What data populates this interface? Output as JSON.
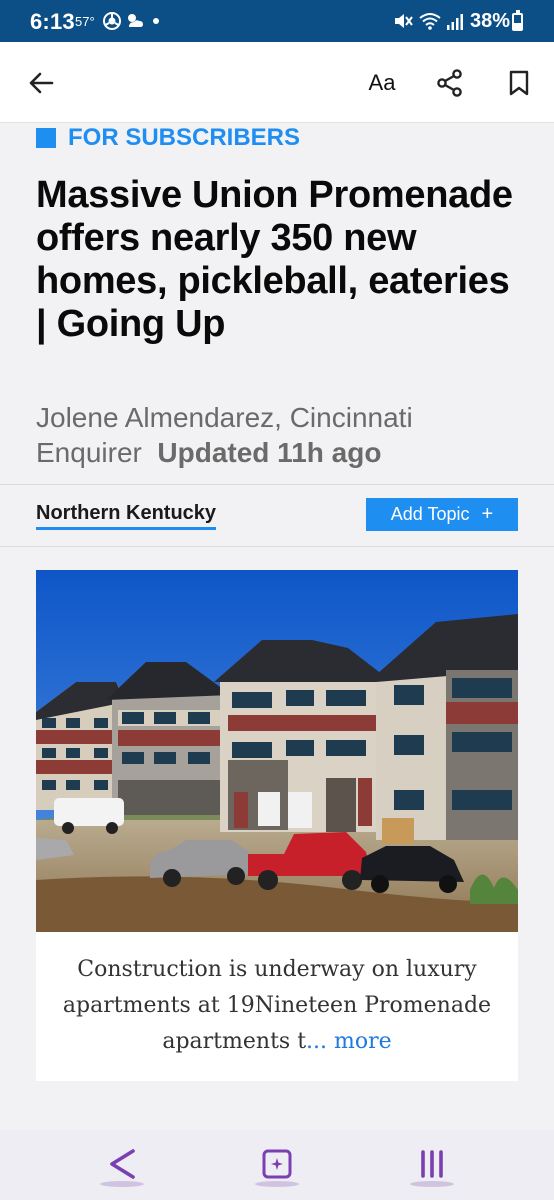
{
  "status_bar": {
    "time": "6:13",
    "temperature": "57°",
    "battery_percent": "38%",
    "icons": [
      "chrome-icon",
      "cloud-sun-icon",
      "mute-icon",
      "wifi-icon",
      "signal-icon",
      "battery-icon"
    ]
  },
  "app_bar": {
    "icons": [
      "back-arrow-icon",
      "text-size-icon",
      "share-icon",
      "bookmark-icon"
    ],
    "text_size_label": "Aa"
  },
  "article": {
    "badge_label": "FOR SUBSCRIBERS",
    "headline": "Massive Union Promenade offers nearly 350 new homes, pickleball, eateries | Going Up",
    "byline_author": "Jolene Almendarez, Cincinnati Enquirer",
    "byline_updated": "Updated 11h ago",
    "topic": "Northern Kentucky",
    "add_topic_label": "Add Topic",
    "add_topic_icon": "plus-icon",
    "caption_text": "Construction is underway on luxury apartments at 19Nineteen Promenade apartments t",
    "caption_more": "... more"
  },
  "nav_bar": {
    "icons": [
      "nav-back-icon",
      "nav-home-icon",
      "nav-recents-icon"
    ]
  },
  "colors": {
    "status_bar_bg": "#0c4f86",
    "accent": "#1e8ef0",
    "headline_text": "#0a0a0a",
    "byline_text": "#6a6a6a",
    "nav_icon": "#7a3fb0"
  }
}
